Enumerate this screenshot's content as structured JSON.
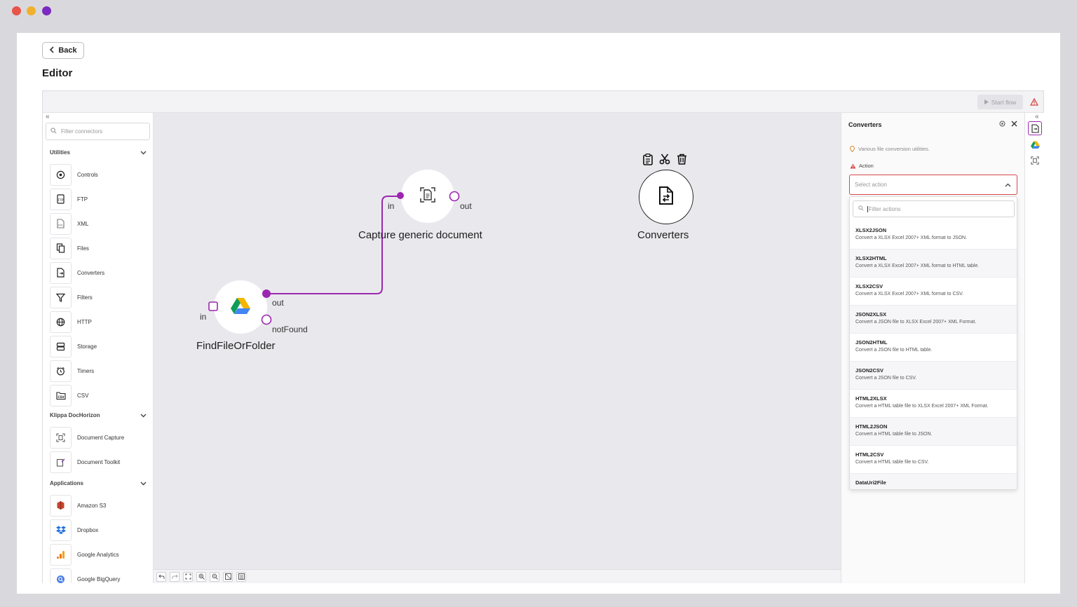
{
  "window": {
    "dots": [
      "#e8534a",
      "#f0b12e",
      "#7b2bbf"
    ]
  },
  "header": {
    "back_label": "Back",
    "title": "Editor"
  },
  "toolbar": {
    "start_flow_label": "Start flow"
  },
  "sidebar": {
    "filter_placeholder": "Filter connectors",
    "sections": [
      {
        "label": "Utilities",
        "items": [
          "Controls",
          "FTP",
          "XML",
          "Files",
          "Converters",
          "Filters",
          "HTTP",
          "Storage",
          "Timers",
          "CSV"
        ]
      },
      {
        "label": "Klippa DocHorizon",
        "items": [
          "Document Capture",
          "Document Toolkit"
        ]
      },
      {
        "label": "Applications",
        "items": [
          "Amazon S3",
          "Dropbox",
          "Google Analytics",
          "Google BigQuery"
        ]
      }
    ]
  },
  "canvas": {
    "nodes": [
      {
        "title": "FindFileOrFolder",
        "ports_in": [
          "in"
        ],
        "ports_out": [
          "out",
          "notFound"
        ]
      },
      {
        "title": "Capture generic document",
        "ports_in": [
          "in"
        ],
        "ports_out": [
          "out"
        ]
      },
      {
        "title": "Converters"
      }
    ]
  },
  "panel": {
    "title": "Converters",
    "description": "Various file conversion utilities.",
    "action_label": "Action",
    "select_placeholder": "Select action",
    "filter_placeholder": "Filter actions",
    "options": [
      {
        "name": "XLSX2JSON",
        "desc": "Convert a XLSX Excel 2007+ XML format to JSON."
      },
      {
        "name": "XLSX2HTML",
        "desc": "Convert a XLSX Excel 2007+ XML format to HTML table."
      },
      {
        "name": "XLSX2CSV",
        "desc": "Convert a XLSX Excel 2007+ XML format to CSV."
      },
      {
        "name": "JSON2XLSX",
        "desc": "Convert a JSON file to XLSX Excel 2007+ XML Format."
      },
      {
        "name": "JSON2HTML",
        "desc": "Convert a JSON file to HTML table."
      },
      {
        "name": "JSON2CSV",
        "desc": "Convert a JSON file to CSV."
      },
      {
        "name": "HTML2XLSX",
        "desc": "Convert a HTML table file to XLSX Excel 2007+ XML Format."
      },
      {
        "name": "HTML2JSON",
        "desc": "Convert a HTML table file to JSON."
      },
      {
        "name": "HTML2CSV",
        "desc": "Convert a HTML table file to CSV."
      },
      {
        "name": "DataUri2File",
        "desc": ""
      }
    ]
  },
  "colors": {
    "accent": "#9b27b0",
    "warning": "#d94848"
  }
}
